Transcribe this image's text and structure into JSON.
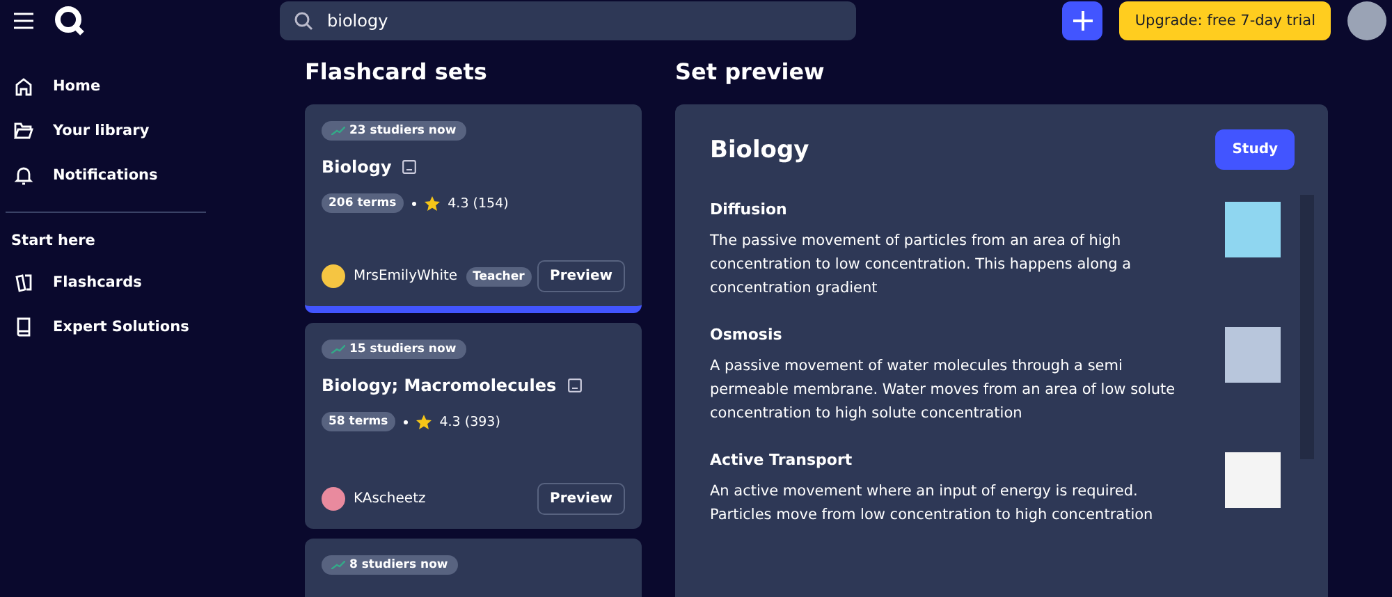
{
  "search": {
    "value": "biology"
  },
  "upgrade_button": "Upgrade: free 7-day trial",
  "sidebar": {
    "items": [
      {
        "label": "Home",
        "kind": "home",
        "selected": false
      },
      {
        "label": "Your library",
        "kind": "folder",
        "selected": false
      },
      {
        "label": "Notifications",
        "kind": "bell",
        "selected": false
      }
    ],
    "section_heading": "Start here",
    "section_items": [
      {
        "label": "Flashcards",
        "kind": "cards",
        "selected": false
      },
      {
        "label": "Expert Solutions",
        "kind": "book",
        "selected": false
      }
    ]
  },
  "flashcard_sets": {
    "heading": "Flashcard sets",
    "cards": [
      {
        "studiers": "23 studiers now",
        "title": "Biology",
        "terms": "206 terms",
        "rating": "4.3 (154)",
        "author": "MrsEmilyWhite",
        "author_badge": "Teacher",
        "button": "Preview",
        "selected": true
      },
      {
        "studiers": "15 studiers now",
        "title": "Biology; Macromolecules",
        "terms": "58 terms",
        "rating": "4.3 (393)",
        "author": "KAscheetz",
        "button": "Preview",
        "selected": false
      },
      {
        "studiers": "8 studiers now"
      }
    ]
  },
  "set_preview": {
    "heading": "Set preview",
    "title": "Biology",
    "button": "Study",
    "terms": [
      {
        "term": "Diffusion",
        "definition": "The passive movement of particles from an area of high concentration to low concentration. This happens along a concentration gradient"
      },
      {
        "term": "Osmosis",
        "definition": "A passive movement of water molecules through a semi permeable membrane. Water moves from an area of low solute concentration to high solute concentration"
      },
      {
        "term": "Active Transport",
        "definition": "An active movement where an input of energy is required. Particles move from low concentration to high concentration"
      }
    ]
  }
}
